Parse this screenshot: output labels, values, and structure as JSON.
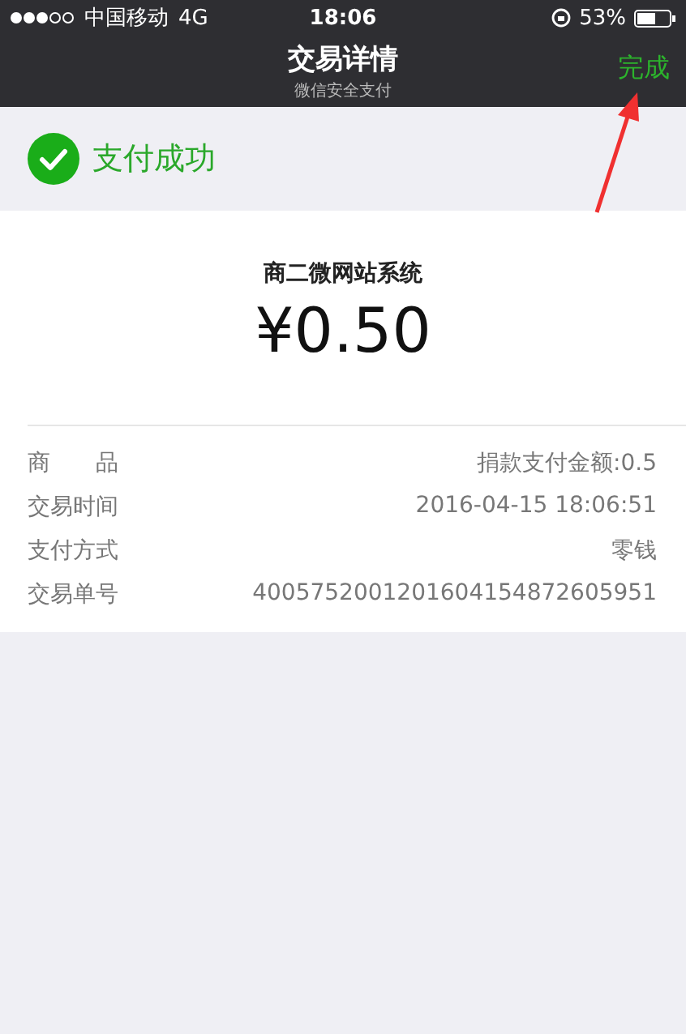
{
  "status_bar": {
    "carrier": "中国移动",
    "network": "4G",
    "time": "18:06",
    "battery": "53%"
  },
  "nav_bar": {
    "title": "交易详情",
    "subtitle": "微信安全支付",
    "action": "完成"
  },
  "result": {
    "text": "支付成功"
  },
  "payment": {
    "merchant": "商二微网站系统",
    "amount": "¥0.50"
  },
  "details": [
    {
      "label": "商　　品",
      "value": "捐款支付金额:0.5"
    },
    {
      "label": "交易时间",
      "value": "2016-04-15 18:06:51"
    },
    {
      "label": "支付方式",
      "value": "零钱"
    },
    {
      "label": "交易单号",
      "value": "4005752001201604154872605951"
    }
  ]
}
